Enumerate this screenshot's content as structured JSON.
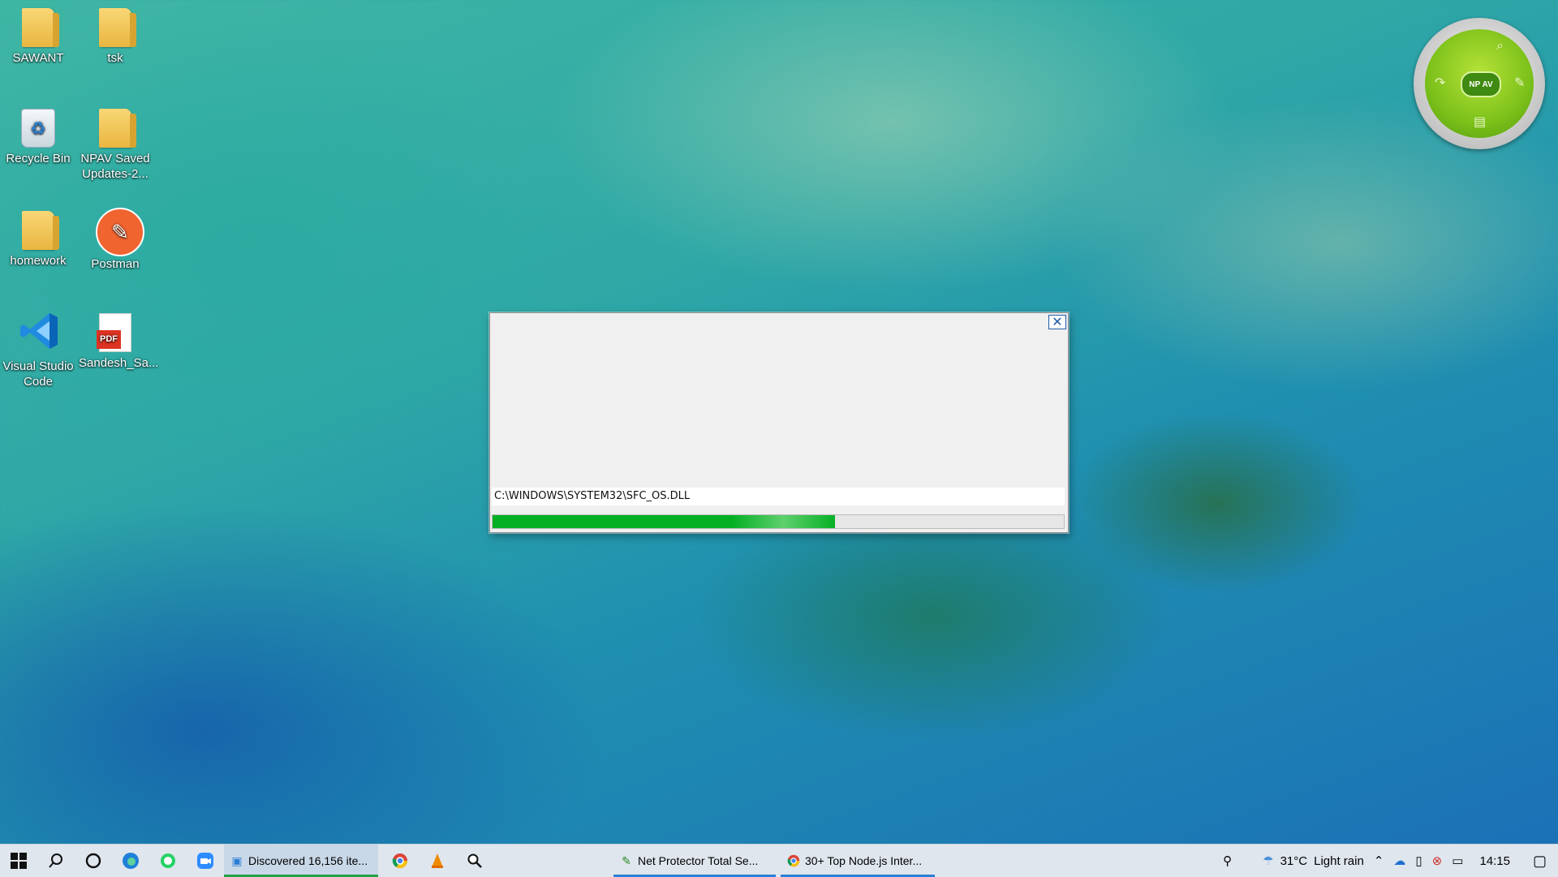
{
  "desktop": {
    "icons": [
      {
        "label": "SAWANT",
        "icon": "user-folder-icon"
      },
      {
        "label": "tsk",
        "icon": "folder-icon"
      },
      {
        "label": "Recycle Bin",
        "icon": "recycle-bin-icon"
      },
      {
        "label": "NPAV Saved Updates-2...",
        "icon": "folder-icon"
      },
      {
        "label": "homework",
        "icon": "folder-icon"
      },
      {
        "label": "Postman",
        "icon": "postman-icon"
      },
      {
        "label": "Visual Studio Code",
        "icon": "vscode-icon"
      },
      {
        "label": "Sandesh_Sa...",
        "icon": "pdf-icon"
      }
    ]
  },
  "dialog": {
    "current_file": "C:\\WINDOWS\\SYSTEM32\\SFC_OS.DLL",
    "progress_fraction": 0.6,
    "close_glyph": "✕"
  },
  "npav_widget": {
    "center_label": "NP AV",
    "search_glyph": "⌕",
    "update_glyph": "↷",
    "tools_glyph": "✎",
    "log_glyph": "▤"
  },
  "taskbar": {
    "apps": [
      {
        "label": "Discovered 16,156 ite...",
        "icon": "windows-search-index-icon",
        "active": true
      },
      {
        "label": "Net Protector Total Se...",
        "icon": "npav-icon",
        "active": false
      },
      {
        "label": "30+ Top Node.js Inter...",
        "icon": "chrome-icon",
        "active": false
      }
    ],
    "tray": {
      "temperature": "31°C",
      "weather": "Light rain",
      "time": "14:15"
    }
  },
  "colors": {
    "progress": "#06b025",
    "taskbar": "#dfe6ee",
    "accent": "#2b7fd6"
  }
}
